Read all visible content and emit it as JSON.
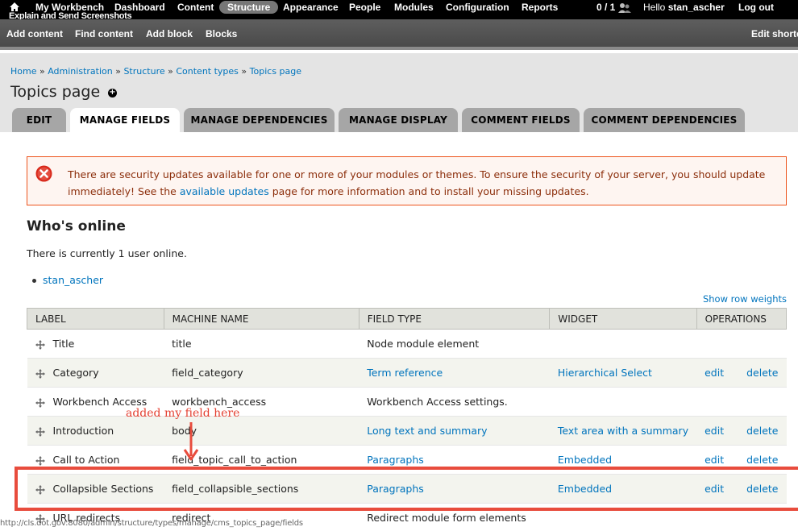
{
  "toolbar": {
    "items": [
      "My Workbench",
      "Dashboard",
      "Content",
      "Structure",
      "Appearance",
      "People",
      "Modules",
      "Configuration",
      "Reports"
    ],
    "active": "Structure",
    "user_count": "0 / 1",
    "greeting_prefix": "Hello",
    "username": "stan_ascher",
    "logout": "Log out",
    "overlay_title": "Explain and Send Screenshots"
  },
  "shortcuts": {
    "items": [
      "Add content",
      "Find content",
      "Add block",
      "Blocks"
    ],
    "edit": "Edit shortcuts"
  },
  "breadcrumb": [
    "Home",
    "Administration",
    "Structure",
    "Content types",
    "Topics page"
  ],
  "page_title": "Topics page",
  "tabs": [
    "EDIT",
    "MANAGE FIELDS",
    "MANAGE DEPENDENCIES",
    "MANAGE DISPLAY",
    "COMMENT FIELDS",
    "COMMENT DEPENDENCIES"
  ],
  "active_tab": "MANAGE FIELDS",
  "message": {
    "part1": "There are security updates available for one or more of your modules or themes. To ensure the security of your server, you should update immediately! See the ",
    "link": "available updates",
    "part2": " page for more information and to install your missing updates."
  },
  "whos_online": {
    "title": "Who's online",
    "text": "There is currently 1 user online.",
    "users": [
      "stan_ascher"
    ]
  },
  "show_row_weights": "Show row weights",
  "table": {
    "columns": [
      "LABEL",
      "MACHINE NAME",
      "FIELD TYPE",
      "WIDGET",
      "OPERATIONS"
    ],
    "rows": [
      {
        "label": "Title",
        "machine": "title",
        "type": "Node module element",
        "type_link": false,
        "widget": "",
        "edit": "",
        "delete": ""
      },
      {
        "label": "Category",
        "machine": "field_category",
        "type": "Term reference",
        "type_link": true,
        "widget": "Hierarchical Select",
        "edit": "edit",
        "delete": "delete"
      },
      {
        "label": "Workbench Access",
        "machine": "workbench_access",
        "type": "Workbench Access settings.",
        "type_link": false,
        "widget": "",
        "edit": "",
        "delete": ""
      },
      {
        "label": "Introduction",
        "machine": "body",
        "type": "Long text and summary",
        "type_link": true,
        "widget": "Text area with a summary",
        "edit": "edit",
        "delete": "delete"
      },
      {
        "label": "Call to Action",
        "machine": "field_topic_call_to_action",
        "type": "Paragraphs",
        "type_link": true,
        "widget": "Embedded",
        "edit": "edit",
        "delete": "delete"
      },
      {
        "label": "Collapsible Sections",
        "machine": "field_collapsible_sections",
        "type": "Paragraphs",
        "type_link": true,
        "widget": "Embedded",
        "edit": "edit",
        "delete": "delete"
      },
      {
        "label": "URL redirects",
        "machine": "redirect",
        "type": "Redirect module form elements",
        "type_link": false,
        "widget": "",
        "edit": "",
        "delete": ""
      }
    ]
  },
  "annotation": {
    "label": "added my field here",
    "color": "#e84c3d"
  },
  "status_url": "http://cls.dot.gov:8080/admin/structure/types/manage/cms_topics_page/fields"
}
